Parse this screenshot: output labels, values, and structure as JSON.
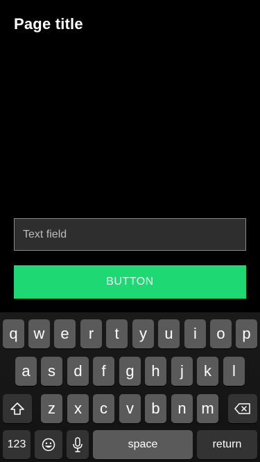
{
  "page": {
    "title": "Page title"
  },
  "form": {
    "text_field_placeholder": "Text field",
    "button_label": "BUTTON"
  },
  "colors": {
    "background": "#000000",
    "button_accent": "#1ed873",
    "field_background": "#2e2e2e",
    "key_background": "#5a5a5a",
    "key_dark_background": "#333333"
  },
  "keyboard": {
    "row1": [
      "q",
      "w",
      "e",
      "r",
      "t",
      "y",
      "u",
      "i",
      "o",
      "p"
    ],
    "row2": [
      "a",
      "s",
      "d",
      "f",
      "g",
      "h",
      "j",
      "k",
      "l"
    ],
    "row3": [
      "z",
      "x",
      "c",
      "v",
      "b",
      "n",
      "m"
    ],
    "shift_icon": "shift-arrow-icon",
    "delete_icon": "backspace-icon",
    "numbers_label": "123",
    "emoji_icon": "emoji-smiley-icon",
    "mic_icon": "microphone-icon",
    "space_label": "space",
    "return_label": "return"
  }
}
